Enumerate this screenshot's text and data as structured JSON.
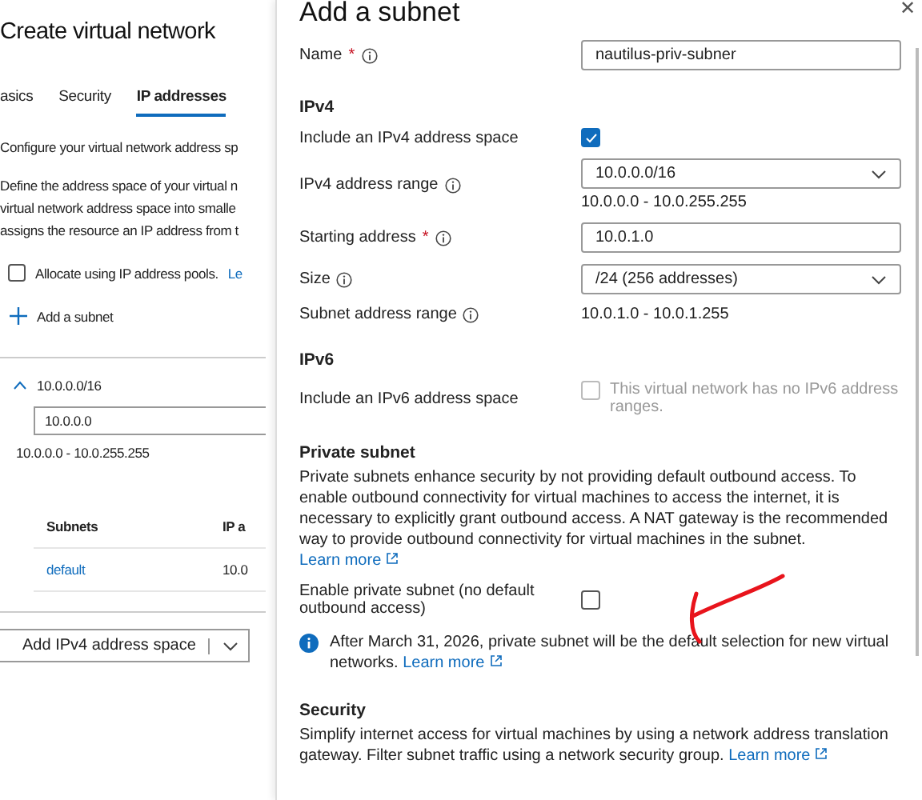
{
  "background_page": {
    "title": "Create virtual network",
    "tabs": [
      {
        "label": "asics",
        "selected": false
      },
      {
        "label": "Security",
        "selected": false
      },
      {
        "label": "IP addresses",
        "selected": true
      }
    ],
    "intro": "Configure your virtual network address sp",
    "description": [
      "Define the address space of your virtual n",
      "virtual network address space into smalle",
      "assigns the resource an IP address from t"
    ],
    "allocate_pools": {
      "label": "Allocate using IP address pools.",
      "link": "Le",
      "checked": false
    },
    "add_subnet": "Add a subnet",
    "address_space": {
      "prefix": "10.0.0.0/16",
      "expanded": true,
      "address": "10.0.0.0",
      "range": "10.0.0.0 - 10.0.255.255",
      "columns": [
        "Subnets",
        "IP a"
      ],
      "rows": [
        [
          "default",
          "10.0"
        ]
      ]
    },
    "add_space_button": "Add IPv4 address space"
  },
  "panel": {
    "title": "Add a subnet",
    "close": "✕",
    "fields": [
      {
        "kind": "text",
        "label": "Name",
        "required_mark": "*",
        "info": true,
        "value": "nautilus-priv-subner"
      },
      {
        "kind": "heading",
        "text": "IPv4"
      },
      {
        "kind": "checkbox",
        "label": "Include an IPv4 address space",
        "checked": true,
        "disabled": false
      },
      {
        "kind": "select",
        "label": "IPv4 address range",
        "info": true,
        "value": "10.0.0.0/16",
        "hint": "10.0.0.0 - 10.0.255.255"
      },
      {
        "kind": "text",
        "label": "Starting address",
        "required_mark": "*",
        "info": true,
        "value": "10.0.1.0"
      },
      {
        "kind": "select",
        "label": "Size",
        "info": true,
        "value": "/24 (256 addresses)"
      },
      {
        "kind": "value",
        "label": "Subnet address range",
        "info": true,
        "value": "10.0.1.0 - 10.0.1.255"
      },
      {
        "kind": "heading",
        "text": "IPv6"
      },
      {
        "kind": "checkbox",
        "label": "Include an IPv6 address space",
        "checked": false,
        "disabled": true,
        "note": "This virtual network has no IPv6 address ranges."
      },
      {
        "kind": "heading",
        "text": "Private subnet"
      },
      {
        "kind": "paragraph",
        "text": "Private subnets enhance security by not providing default outbound access. To enable outbound connectivity for virtual machines to access the internet, it is necessary to explicitly grant outbound access. A NAT gateway is the recommended way to provide outbound connectivity for virtual machines in the subnet.",
        "link": "Learn more"
      },
      {
        "kind": "checkbox",
        "label": "Enable private subnet (no default outbound access)",
        "checked": false,
        "disabled": false
      },
      {
        "kind": "info",
        "text": "After March 31, 2026, private subnet will be the default selection for new virtual networks.",
        "link": "Learn more"
      },
      {
        "kind": "heading",
        "text": "Security"
      },
      {
        "kind": "paragraph",
        "text": "Simplify internet access for virtual machines by using a network address translation gateway. Filter subnet traffic using a network security group.",
        "link": "Learn more"
      }
    ]
  }
}
